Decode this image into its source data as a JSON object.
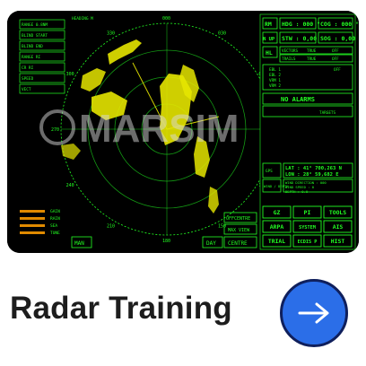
{
  "card": {
    "title": "Radar Training",
    "action_icon": "arrow-right-icon",
    "colors": {
      "button": "#2b6ee8",
      "button_border": "#0f1f5c",
      "radar_green": "#22ff22",
      "echo_yellow": "#e6e600",
      "title_text": "#1d1d1d"
    }
  },
  "radar": {
    "watermark": "MARSIM",
    "left_panel": [
      {
        "label": "RANGE 0.8NM",
        "value": ""
      },
      {
        "label": "BLIND START",
        "value": "0"
      },
      {
        "label": "BLIND END",
        "value": "0"
      },
      {
        "label": "RANGE RI",
        "value": ""
      },
      {
        "label": "CR RI",
        "value": ""
      },
      {
        "label": "SPEED",
        "value": ""
      },
      {
        "label": "VECT",
        "value": ""
      },
      {
        "label": "RT",
        "value": ""
      }
    ],
    "top_center_label": "HEADING M",
    "level_labels": [
      "GAIN",
      "RAIN",
      "SEA",
      "TUNE"
    ],
    "bearing_labels": [
      "000",
      "030",
      "060",
      "090",
      "120",
      "150",
      "180",
      "210",
      "240",
      "270",
      "300",
      "330"
    ],
    "right_panel": {
      "rm": "RM",
      "n_up": "N UP",
      "hl": "HL",
      "hdg": "HDG : 000 °",
      "cog": "COG : 000 °",
      "stw": "STW : 0,00",
      "sog": "SOG : 0,00",
      "vectors": "VECTORS",
      "true": "TRUE",
      "off": "OFF",
      "trails": "TRAILS",
      "trails_true": "TRUE",
      "trails_off": "OFF",
      "ebl1": "EBL 1",
      "ebl2": "EBL 2",
      "vrm1": "VRM 1",
      "vrm2": "VRM 2",
      "vrm_off": "OFF",
      "no_alarms": "NO ALARMS",
      "targets": "TARGETS",
      "gps": "GPS",
      "lat": "LAT : 41° 700,263 N",
      "lon": "LON : 28° 59,682 E",
      "wind": "WIND / DEPTH",
      "wind_dir": "WIND DIRECTION : 000",
      "wind_speed": "WIND SPEED : 0",
      "depth": "DEPTH : 0.0",
      "buttons": [
        "GZ",
        "PI",
        "TOOLS",
        "ARPA",
        "SYSTEM",
        "AIS",
        "TRIAL",
        "ECDIS P",
        "HIST"
      ]
    },
    "bottom_left": "MAN",
    "bottom_right": [
      "DAY",
      "CENTRE"
    ],
    "off_centre": "OFFCENTRE",
    "max_view": "MAX VIEW"
  }
}
